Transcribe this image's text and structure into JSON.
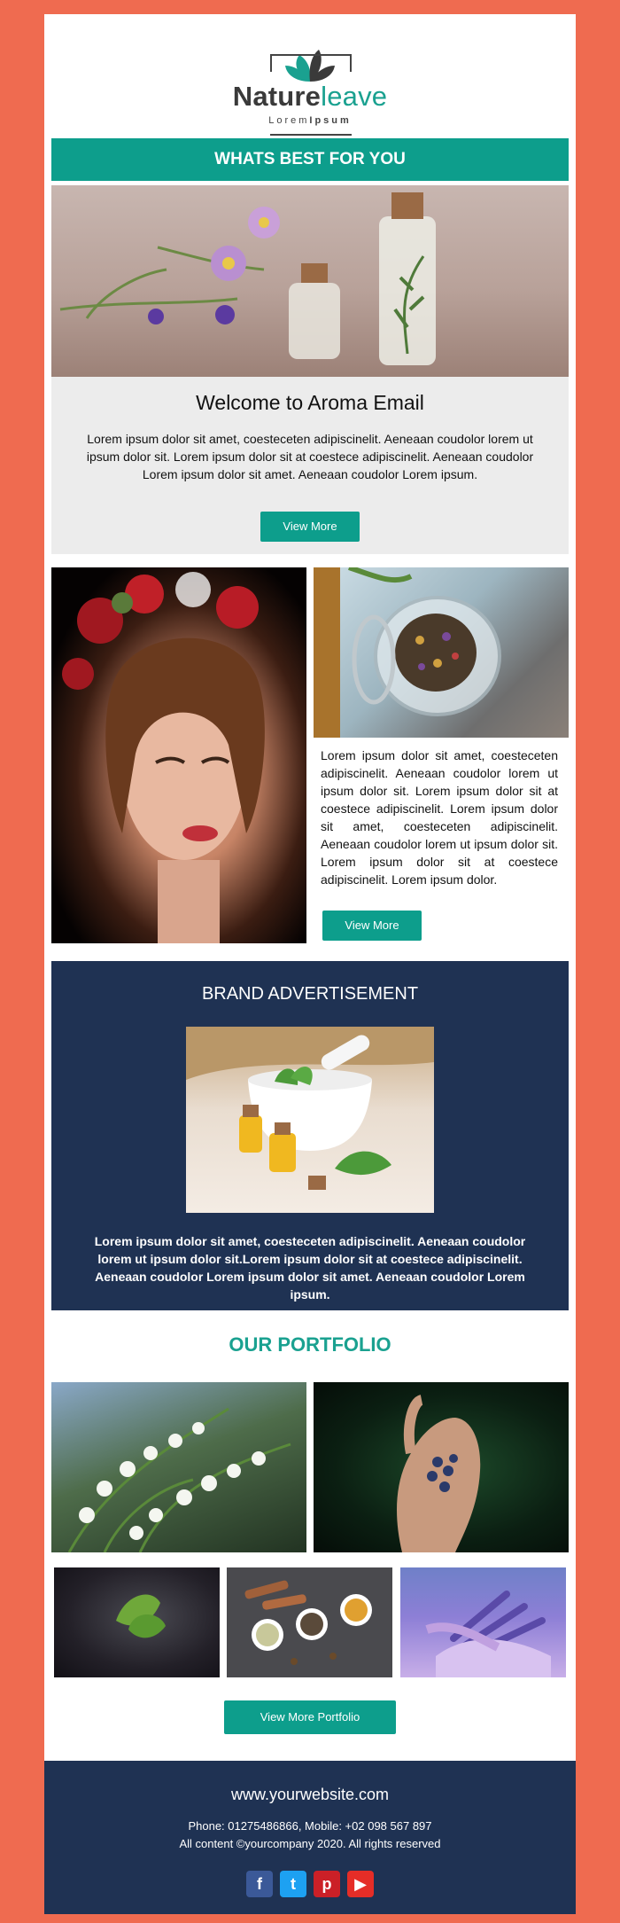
{
  "logo": {
    "name_part1": "Nature",
    "name_part2": "leave",
    "sub_part1": "Lorem",
    "sub_part2": "Ipsum"
  },
  "banner": {
    "title": "WHATS BEST FOR YOU"
  },
  "welcome": {
    "title": "Welcome to Aroma Email",
    "body": "Lorem ipsum dolor sit amet, coesteceten adipiscinelit. Aeneaan coudolor lorem ut ipsum dolor sit. Lorem ipsum dolor sit at coestece adipiscinelit. Aeneaan coudolor Lorem ipsum dolor sit amet. Aeneaan coudolor Lorem ipsum.",
    "button": "View More"
  },
  "feature": {
    "body": "Lorem ipsum dolor sit amet, coesteceten adipiscinelit. Aeneaan coudolor lorem ut ipsum dolor sit. Lorem ipsum dolor sit at coestece adipiscinelit. Lorem ipsum dolor sit amet, coesteceten adipiscinelit. Aeneaan coudolor lorem ut ipsum dolor sit. Lorem ipsum dolor sit at coestece adipiscinelit. Lorem ipsum dolor.",
    "button": "View More"
  },
  "brand": {
    "title": "BRAND ADVERTISEMENT",
    "body": "Lorem ipsum dolor sit amet, coesteceten adipiscinelit. Aeneaan coudolor lorem ut ipsum dolor sit.Lorem ipsum dolor sit at coestece adipiscinelit. Aeneaan coudolor Lorem ipsum dolor sit amet. Aeneaan coudolor Lorem ipsum."
  },
  "portfolio": {
    "title": "OUR PORTFOLIO",
    "button": "View More Portfolio"
  },
  "footer": {
    "website": "www.yourwebsite.com",
    "phone": "Phone: 01275486866, Mobile: +02 098 567 897",
    "rights": "All content ©yourcompany 2020. All rights reserved",
    "socials": [
      {
        "icon": "facebook-icon",
        "glyph": "f"
      },
      {
        "icon": "twitter-icon",
        "glyph": "t"
      },
      {
        "icon": "pinterest-icon",
        "glyph": "p"
      },
      {
        "icon": "youtube-icon",
        "glyph": "▶"
      }
    ]
  },
  "colors": {
    "accent": "#0d9e8c",
    "navy": "#1f3253",
    "page_bg": "#ef6b50"
  }
}
